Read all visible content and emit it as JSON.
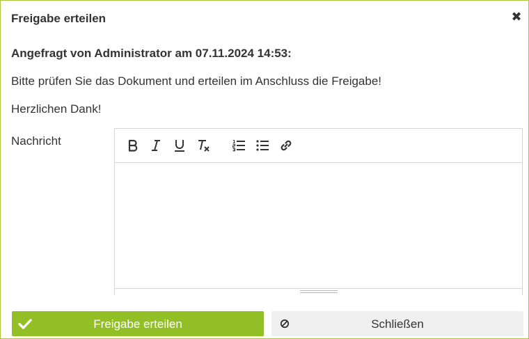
{
  "dialog": {
    "title": "Freigabe erteilen",
    "close_glyph": "✖"
  },
  "content": {
    "requested_by": "Angefragt von Administrator am 07.11.2024 14:53:",
    "instruction": "Bitte prüfen Sie das Dokument und erteilen im Anschluss die Freigabe!",
    "thanks": "Herzlichen Dank!"
  },
  "message": {
    "label": "Nachricht",
    "value": "",
    "toolbar": [
      {
        "name": "bold-icon",
        "label": "B"
      },
      {
        "name": "italic-icon",
        "label": "I"
      },
      {
        "name": "underline-icon",
        "label": "U"
      },
      {
        "name": "clear-format-icon",
        "label": "Tx"
      },
      {
        "name": "ordered-list-icon",
        "label": ""
      },
      {
        "name": "bullet-list-icon",
        "label": ""
      },
      {
        "name": "link-icon",
        "label": ""
      }
    ]
  },
  "buttons": {
    "approve_label": "Freigabe erteilen",
    "approve_icon": "check-icon",
    "close_label": "Schließen",
    "close_icon": "ban-icon"
  },
  "colors": {
    "accent": "#93bf26",
    "border": "#a8c43a",
    "secondary_button": "#efefef",
    "text": "#333333"
  }
}
